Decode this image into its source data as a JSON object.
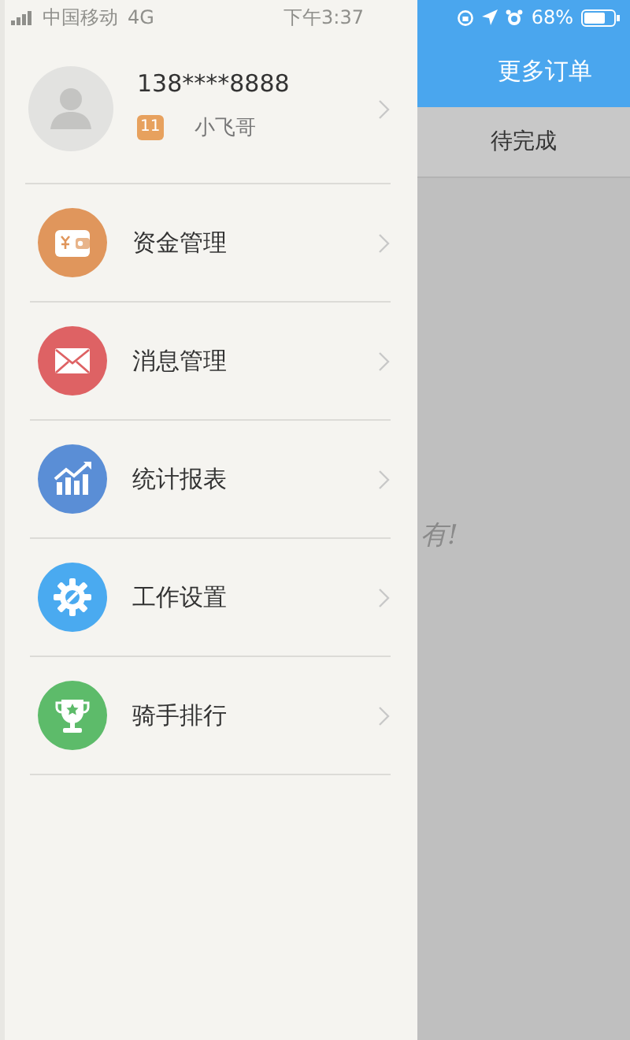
{
  "status_bar": {
    "carrier": "中国移动",
    "network": "4G",
    "time": "下午3:37",
    "battery": "68%"
  },
  "drawer": {
    "profile": {
      "phone": "138****8888",
      "level": "11",
      "name": "小飞哥"
    },
    "menu": [
      {
        "label": "资金管理",
        "kind": "wallet",
        "color": "#e0965c"
      },
      {
        "label": "消息管理",
        "kind": "mail",
        "color": "#de6264"
      },
      {
        "label": "统计报表",
        "kind": "chart",
        "color": "#5a8ed6"
      },
      {
        "label": "工作设置",
        "kind": "settings",
        "color": "#4aaaf0"
      },
      {
        "label": "骑手排行",
        "kind": "trophy",
        "color": "#5dbb6a"
      }
    ]
  },
  "main": {
    "header_title": "更多订单",
    "tab": "待完成",
    "empty_text": "有!"
  }
}
